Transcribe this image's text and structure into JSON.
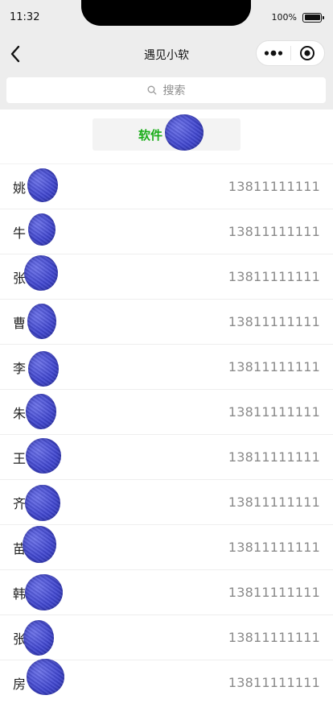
{
  "status_bar": {
    "time": "11:32",
    "battery_percent_text": "100%",
    "battery_level": 1.0
  },
  "nav": {
    "title": "遇见小软",
    "back_icon": "chevron-left-icon",
    "more_icon": "more-dots-icon",
    "close_icon": "target-circle-icon"
  },
  "search": {
    "placeholder": "搜索",
    "icon": "search-icon"
  },
  "group": {
    "label": "软件"
  },
  "contacts": [
    {
      "name": "姚",
      "phone": "13811111111"
    },
    {
      "name": "牛",
      "phone": "13811111111"
    },
    {
      "name": "张",
      "phone": "13811111111"
    },
    {
      "name": "曹",
      "phone": "13811111111"
    },
    {
      "name": "李",
      "phone": "13811111111"
    },
    {
      "name": "朱",
      "phone": "13811111111"
    },
    {
      "name": "王",
      "phone": "13811111111"
    },
    {
      "name": "齐",
      "phone": "13811111111"
    },
    {
      "name": "苗",
      "phone": "13811111111"
    },
    {
      "name": "韩",
      "phone": "13811111111"
    },
    {
      "name": "张",
      "phone": "13811111111"
    },
    {
      "name": "房",
      "phone": "13811111111"
    }
  ],
  "colors": {
    "accent_green": "#1aad19",
    "nav_background": "#ededed",
    "redaction_blue": "#4046d0"
  }
}
